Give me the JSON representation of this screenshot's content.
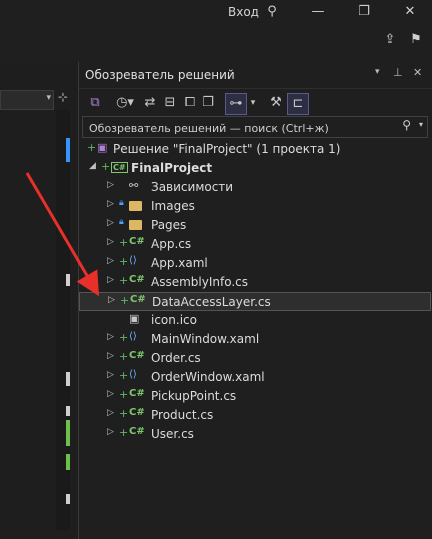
{
  "titlebar": {
    "login_label": "Вход"
  },
  "panel": {
    "title": "Обозреватель решений",
    "search_placeholder": "Обозреватель решений — поиск (Ctrl+ж)"
  },
  "tree": {
    "solution": "Решение \"FinalProject\"  (1 проекта 1)",
    "project": "FinalProject",
    "items": [
      {
        "label": "Зависимости",
        "kind": "deps"
      },
      {
        "label": "Images",
        "kind": "folder"
      },
      {
        "label": "Pages",
        "kind": "folder"
      },
      {
        "label": "App.cs",
        "kind": "cs"
      },
      {
        "label": "App.xaml",
        "kind": "xaml"
      },
      {
        "label": "AssemblyInfo.cs",
        "kind": "cs"
      },
      {
        "label": "DataAccessLayer.cs",
        "kind": "cs"
      },
      {
        "label": "icon.ico",
        "kind": "ico"
      },
      {
        "label": "MainWindow.xaml",
        "kind": "xaml"
      },
      {
        "label": "Order.cs",
        "kind": "cs"
      },
      {
        "label": "OrderWindow.xaml",
        "kind": "xaml"
      },
      {
        "label": "PickupPoint.cs",
        "kind": "cs"
      },
      {
        "label": "Product.cs",
        "kind": "cs"
      },
      {
        "label": "User.cs",
        "kind": "cs"
      }
    ]
  },
  "selected_item": "DataAccessLayer.cs",
  "colors": {
    "accent": "#3794ff",
    "arrow": "#e8302a",
    "csharp": "#7ec76e",
    "folder": "#dcb862"
  }
}
